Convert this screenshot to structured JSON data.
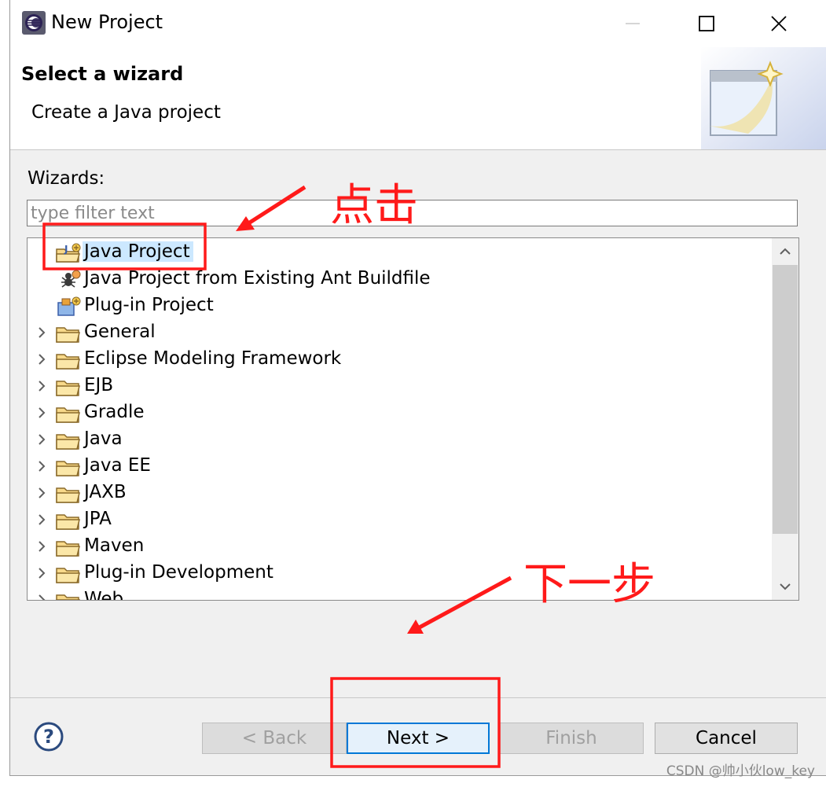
{
  "window": {
    "title": "New Project",
    "title_icon": "eclipse-app-icon",
    "controls": [
      "minimize-icon",
      "maximize-icon",
      "close-icon"
    ]
  },
  "banner": {
    "title": "Select a wizard",
    "description": "Create a Java project",
    "art_icon": "new-wizard-banner-icon"
  },
  "wizards": {
    "label": "Wizards:",
    "filter_placeholder": "type filter text",
    "filter_value": "",
    "items": [
      {
        "label": "Java Project",
        "icon": "java-project-icon",
        "expandable": false,
        "selected": true
      },
      {
        "label": "Java Project from Existing Ant Buildfile",
        "icon": "ant-icon",
        "expandable": false,
        "selected": false
      },
      {
        "label": "Plug-in Project",
        "icon": "plugin-project-icon",
        "expandable": false,
        "selected": false
      },
      {
        "label": "General",
        "icon": "folder-icon",
        "expandable": true,
        "selected": false
      },
      {
        "label": "Eclipse Modeling Framework",
        "icon": "folder-icon",
        "expandable": true,
        "selected": false
      },
      {
        "label": "EJB",
        "icon": "folder-icon",
        "expandable": true,
        "selected": false
      },
      {
        "label": "Gradle",
        "icon": "folder-icon",
        "expandable": true,
        "selected": false
      },
      {
        "label": "Java",
        "icon": "folder-icon",
        "expandable": true,
        "selected": false
      },
      {
        "label": "Java EE",
        "icon": "folder-icon",
        "expandable": true,
        "selected": false
      },
      {
        "label": "JAXB",
        "icon": "folder-icon",
        "expandable": true,
        "selected": false
      },
      {
        "label": "JPA",
        "icon": "folder-icon",
        "expandable": true,
        "selected": false
      },
      {
        "label": "Maven",
        "icon": "folder-icon",
        "expandable": true,
        "selected": false
      },
      {
        "label": "Plug-in Development",
        "icon": "folder-icon",
        "expandable": true,
        "selected": false
      },
      {
        "label": "Web",
        "icon": "folder-icon",
        "expandable": true,
        "selected": false
      }
    ]
  },
  "buttons": {
    "back": "< Back",
    "next": "Next >",
    "finish": "Finish",
    "cancel": "Cancel",
    "help_icon": "help-icon"
  },
  "annotations": {
    "click_text": "点击",
    "next_step_text": "下一步",
    "color": "#ff1a1a"
  },
  "watermark": "CSDN @帅小伙low_key",
  "colors": {
    "selection": "#cce8ff",
    "default_button_border": "#0078d7",
    "dialog_bg": "#f0f0f0"
  }
}
